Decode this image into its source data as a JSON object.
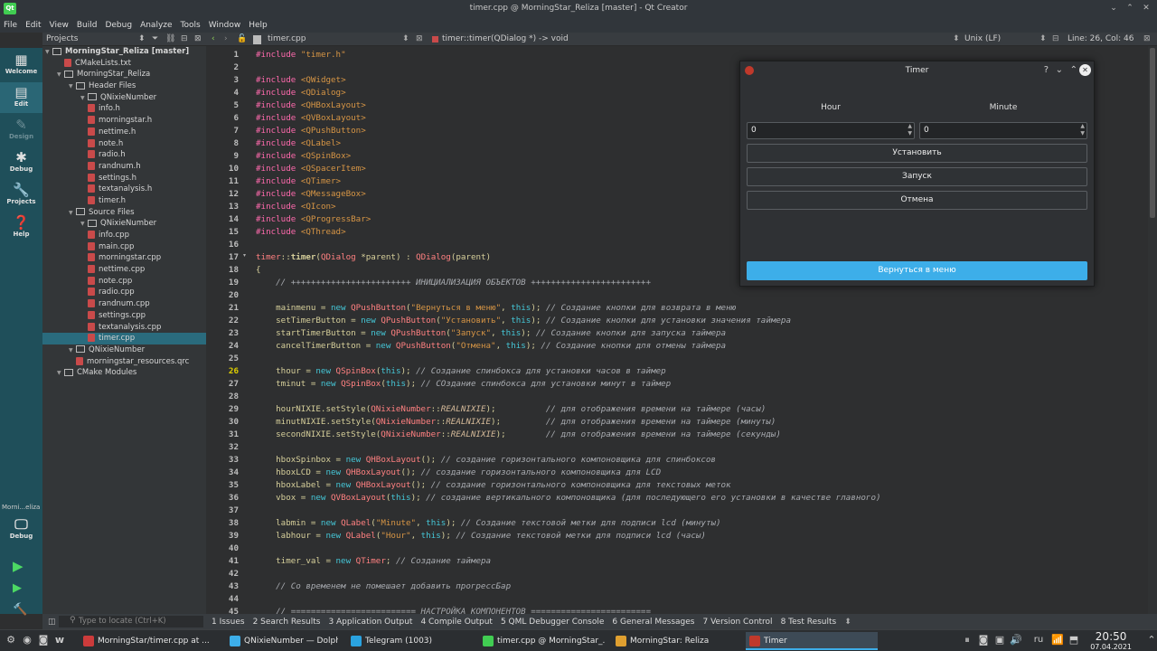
{
  "window": {
    "title": "timer.cpp @ MorningStar_Reliza [master] - Qt Creator"
  },
  "menu": [
    "File",
    "Edit",
    "View",
    "Build",
    "Debug",
    "Analyze",
    "Tools",
    "Window",
    "Help"
  ],
  "modes": [
    {
      "label": "Welcome",
      "icon": "grid-icon"
    },
    {
      "label": "Edit",
      "icon": "edit-icon"
    },
    {
      "label": "Design",
      "icon": "pen-icon"
    },
    {
      "label": "Debug",
      "icon": "bug-icon"
    },
    {
      "label": "Projects",
      "icon": "wrench-icon"
    },
    {
      "label": "Help",
      "icon": "help-icon"
    }
  ],
  "kit": {
    "name": "Morni...eliza",
    "label": "Debug"
  },
  "projects": {
    "header": "Projects",
    "tree": [
      {
        "text": "MorningStar_Reliza [master]",
        "level": 0,
        "kind": "project",
        "bold": true
      },
      {
        "text": "CMakeLists.txt",
        "level": 1,
        "kind": "file"
      },
      {
        "text": "MorningStar_Reliza",
        "level": 1,
        "kind": "target"
      },
      {
        "text": "Header Files",
        "level": 2,
        "kind": "folder"
      },
      {
        "text": "QNixieNumber",
        "level": 3,
        "kind": "folder"
      },
      {
        "text": "info.h",
        "level": 3,
        "kind": "file"
      },
      {
        "text": "morningstar.h",
        "level": 3,
        "kind": "file"
      },
      {
        "text": "nettime.h",
        "level": 3,
        "kind": "file"
      },
      {
        "text": "note.h",
        "level": 3,
        "kind": "file"
      },
      {
        "text": "radio.h",
        "level": 3,
        "kind": "file"
      },
      {
        "text": "randnum.h",
        "level": 3,
        "kind": "file"
      },
      {
        "text": "settings.h",
        "level": 3,
        "kind": "file"
      },
      {
        "text": "textanalysis.h",
        "level": 3,
        "kind": "file"
      },
      {
        "text": "timer.h",
        "level": 3,
        "kind": "file"
      },
      {
        "text": "Source Files",
        "level": 2,
        "kind": "folder"
      },
      {
        "text": "QNixieNumber",
        "level": 3,
        "kind": "folder"
      },
      {
        "text": "info.cpp",
        "level": 3,
        "kind": "file"
      },
      {
        "text": "main.cpp",
        "level": 3,
        "kind": "file"
      },
      {
        "text": "morningstar.cpp",
        "level": 3,
        "kind": "file"
      },
      {
        "text": "nettime.cpp",
        "level": 3,
        "kind": "file"
      },
      {
        "text": "note.cpp",
        "level": 3,
        "kind": "file"
      },
      {
        "text": "radio.cpp",
        "level": 3,
        "kind": "file"
      },
      {
        "text": "randnum.cpp",
        "level": 3,
        "kind": "file"
      },
      {
        "text": "settings.cpp",
        "level": 3,
        "kind": "file"
      },
      {
        "text": "textanalysis.cpp",
        "level": 3,
        "kind": "file"
      },
      {
        "text": "timer.cpp",
        "level": 3,
        "kind": "file",
        "selected": true
      },
      {
        "text": "QNixieNumber",
        "level": 2,
        "kind": "folder"
      },
      {
        "text": "morningstar_resources.qrc",
        "level": 2,
        "kind": "file"
      },
      {
        "text": "CMake Modules",
        "level": 1,
        "kind": "folder"
      }
    ]
  },
  "editor": {
    "filename": "timer.cpp",
    "symbol": "timer::timer(QDialog *) -> void",
    "line_ending": "Unix (LF)",
    "position": "Line: 26, Col: 46",
    "current_line": 26,
    "lines": [
      {
        "n": 1,
        "html": "<span class=\"mc\">#include</span> <span class=\"st\">\"timer.h\"</span>"
      },
      {
        "n": 2,
        "html": ""
      },
      {
        "n": 3,
        "html": "<span class=\"mc\">#include</span> <span class=\"st\">&lt;QWidget&gt;</span>"
      },
      {
        "n": 4,
        "html": "<span class=\"mc\">#include</span> <span class=\"st\">&lt;QDialog&gt;</span>"
      },
      {
        "n": 5,
        "html": "<span class=\"mc\">#include</span> <span class=\"st\">&lt;QHBoxLayout&gt;</span>"
      },
      {
        "n": 6,
        "html": "<span class=\"mc\">#include</span> <span class=\"st\">&lt;QVBoxLayout&gt;</span>"
      },
      {
        "n": 7,
        "html": "<span class=\"mc\">#include</span> <span class=\"st\">&lt;QPushButton&gt;</span>"
      },
      {
        "n": 8,
        "html": "<span class=\"mc\">#include</span> <span class=\"st\">&lt;QLabel&gt;</span>"
      },
      {
        "n": 9,
        "html": "<span class=\"mc\">#include</span> <span class=\"st\">&lt;QSpinBox&gt;</span>"
      },
      {
        "n": 10,
        "html": "<span class=\"mc\">#include</span> <span class=\"st\">&lt;QSpacerItem&gt;</span>"
      },
      {
        "n": 11,
        "html": "<span class=\"mc\">#include</span> <span class=\"st\">&lt;QTimer&gt;</span>"
      },
      {
        "n": 12,
        "html": "<span class=\"mc\">#include</span> <span class=\"st\">&lt;QMessageBox&gt;</span>"
      },
      {
        "n": 13,
        "html": "<span class=\"mc\">#include</span> <span class=\"st\">&lt;QIcon&gt;</span>"
      },
      {
        "n": 14,
        "html": "<span class=\"mc\">#include</span> <span class=\"st\">&lt;QProgressBar&gt;</span>"
      },
      {
        "n": 15,
        "html": "<span class=\"mc\">#include</span> <span class=\"st\">&lt;QThread&gt;</span>"
      },
      {
        "n": 16,
        "html": ""
      },
      {
        "n": 17,
        "html": "<span class=\"ty\">timer</span>::<span class=\"fn\">timer</span>(<span class=\"ty\">QDialog</span> *parent) : <span class=\"ty\">QDialog</span>(parent)"
      },
      {
        "n": 18,
        "html": "{"
      },
      {
        "n": 19,
        "html": "    <span class=\"cm\">// ++++++++++++++++++++++++ ИНИЦИАЛИЗАЦИЯ ОБЪЕКТОВ ++++++++++++++++++++++++</span>"
      },
      {
        "n": 20,
        "html": ""
      },
      {
        "n": 21,
        "html": "    mainmenu = <span class=\"kw\">new</span> <span class=\"ty\">QPushButton</span>(<span class=\"st\">\"Вернуться в меню\"</span>, <span class=\"kw\">this</span>); <span class=\"cm\">// Создание кнопки для возврата в меню</span>"
      },
      {
        "n": 22,
        "html": "    setTimerButton = <span class=\"kw\">new</span> <span class=\"ty\">QPushButton</span>(<span class=\"st\">\"Установить\"</span>, <span class=\"kw\">this</span>); <span class=\"cm\">// Создание кнопки для установки значения таймера</span>"
      },
      {
        "n": 23,
        "html": "    startTimerButton = <span class=\"kw\">new</span> <span class=\"ty\">QPushButton</span>(<span class=\"st\">\"Запуск\"</span>, <span class=\"kw\">this</span>); <span class=\"cm\">// Создание кнопки для запуска таймера</span>"
      },
      {
        "n": 24,
        "html": "    cancelTimerButton = <span class=\"kw\">new</span> <span class=\"ty\">QPushButton</span>(<span class=\"st\">\"Отмена\"</span>, <span class=\"kw\">this</span>); <span class=\"cm\">// Создание кнопки для отмены таймера</span>"
      },
      {
        "n": 25,
        "html": ""
      },
      {
        "n": 26,
        "html": "    thour = <span class=\"kw\">new</span> <span class=\"ty\">QSpinBox</span>(<span class=\"kw\">this</span>); <span class=\"cm\">// Создание спинбокса для установки часов в таймер</span>"
      },
      {
        "n": 27,
        "html": "    tminut = <span class=\"kw\">new</span> <span class=\"ty\">QSpinBox</span>(<span class=\"kw\">this</span>); <span class=\"cm\">// СОздание спинбокса для установки минут в таймер</span>"
      },
      {
        "n": 28,
        "html": ""
      },
      {
        "n": 29,
        "html": "    hourNIXIE.setStyle(<span class=\"ty\">QNixieNumber</span>::<span class=\"en\">REALNIXIE</span>);          <span class=\"cm\">// для отображения времени на таймере (часы)</span>"
      },
      {
        "n": 30,
        "html": "    minutNIXIE.setStyle(<span class=\"ty\">QNixieNumber</span>::<span class=\"en\">REALNIXIE</span>);         <span class=\"cm\">// для отображения времени на таймере (минуты)</span>"
      },
      {
        "n": 31,
        "html": "    secondNIXIE.setStyle(<span class=\"ty\">QNixieNumber</span>::<span class=\"en\">REALNIXIE</span>);        <span class=\"cm\">// для отображения времени на таймере (секунды)</span>"
      },
      {
        "n": 32,
        "html": ""
      },
      {
        "n": 33,
        "html": "    hboxSpinbox = <span class=\"kw\">new</span> <span class=\"ty\">QHBoxLayout</span>(); <span class=\"cm\">// создание горизонтального компоновщика для спинбоксов</span>"
      },
      {
        "n": 34,
        "html": "    hboxLCD = <span class=\"kw\">new</span> <span class=\"ty\">QHBoxLayout</span>(); <span class=\"cm\">// создание горизонтального компоновщика для LCD</span>"
      },
      {
        "n": 35,
        "html": "    hboxLabel = <span class=\"kw\">new</span> <span class=\"ty\">QHBoxLayout</span>(); <span class=\"cm\">// создание горизонтального компоновщика для текстовых меток</span>"
      },
      {
        "n": 36,
        "html": "    vbox = <span class=\"kw\">new</span> <span class=\"ty\">QVBoxLayout</span>(<span class=\"kw\">this</span>); <span class=\"cm\">// создание вертикального компоновщика (для последующего его установки в качестве главного)</span>"
      },
      {
        "n": 37,
        "html": ""
      },
      {
        "n": 38,
        "html": "    labmin = <span class=\"kw\">new</span> <span class=\"ty\">QLabel</span>(<span class=\"st\">\"Minute\"</span>, <span class=\"kw\">this</span>); <span class=\"cm\">// Создание текстовой метки для подписи lcd (минуты)</span>"
      },
      {
        "n": 39,
        "html": "    labhour = <span class=\"kw\">new</span> <span class=\"ty\">QLabel</span>(<span class=\"st\">\"Hour\"</span>, <span class=\"kw\">this</span>); <span class=\"cm\">// Создание текстовой метки для подписи lcd (часы)</span>"
      },
      {
        "n": 40,
        "html": ""
      },
      {
        "n": 41,
        "html": "    timer_val = <span class=\"kw\">new</span> <span class=\"ty\">QTimer</span>; <span class=\"cm\">// Создание таймера</span>"
      },
      {
        "n": 42,
        "html": ""
      },
      {
        "n": 43,
        "html": "    <span class=\"cm\">// Со временем не помешает добавить прогрессБар</span>"
      },
      {
        "n": 44,
        "html": ""
      },
      {
        "n": 45,
        "html": "    <span class=\"cm\">// ========================= НАСТРОЙКА КОМПОНЕНТОВ ========================</span>"
      }
    ]
  },
  "outputbar": {
    "locator_placeholder": "Type to locate (Ctrl+K)",
    "panes": [
      "1 Issues",
      "2 Search Results",
      "3 Application Output",
      "4 Compile Output",
      "5 QML Debugger Console",
      "6 General Messages",
      "7 Version Control",
      "8 Test Results"
    ]
  },
  "dialog": {
    "title": "Timer",
    "hour_label": "Hour",
    "minute_label": "Minute",
    "hour_value": "0",
    "minute_value": "0",
    "set_button": "Установить",
    "start_button": "Запуск",
    "cancel_button": "Отмена",
    "menu_button": "Вернуться в меню"
  },
  "taskbar": {
    "tasks": [
      {
        "label": "MorningStar/timer.cpp at ...",
        "color": "#cc3b3b"
      },
      {
        "label": "QNixieNumber — Dolphin",
        "color": "#3daee9"
      },
      {
        "label": "Telegram (1003)",
        "color": "#2aa3e0"
      },
      {
        "label": "timer.cpp @ MorningStar_...",
        "color": "#41cd52"
      },
      {
        "label": "MorningStar: Reliza",
        "color": "#e0a030"
      },
      {
        "label": "Timer",
        "color": "#c0392b",
        "active": true
      }
    ],
    "language": "ru",
    "time": "20:50",
    "date": "07.04.2021"
  }
}
